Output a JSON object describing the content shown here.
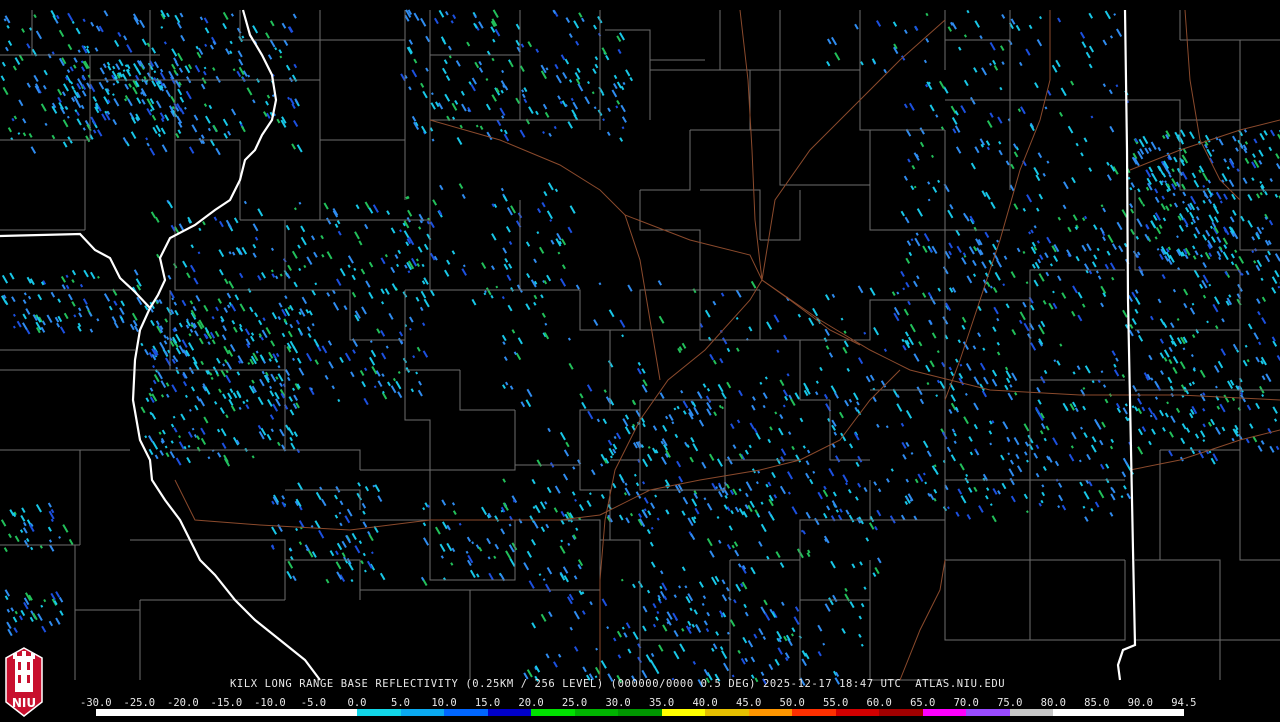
{
  "caption": {
    "text": "KILX LONG RANGE BASE REFLECTIVITY (0.25KM / 256 LEVEL) (000000/0000 0.5 DEG) 2025-12-17 18:47 UTC  ATLAS.NIU.EDU"
  },
  "logo": {
    "text": "NIU",
    "colors": {
      "bg": "#c8102e",
      "fg": "#ffffff"
    }
  },
  "color_scale": {
    "labels": [
      "-30.0",
      "-25.0",
      "-20.0",
      "-15.0",
      "-10.0",
      "-5.0",
      "0.0",
      "5.0",
      "10.0",
      "15.0",
      "20.0",
      "25.0",
      "30.0",
      "35.0",
      "40.0",
      "45.0",
      "50.0",
      "55.0",
      "60.0",
      "65.0",
      "70.0",
      "75.0",
      "80.0",
      "85.0",
      "90.0",
      "94.5"
    ],
    "colors": [
      "#ffffff",
      "#ffffff",
      "#ffffff",
      "#ffffff",
      "#ffffff",
      "#ffffff",
      "#12d6e8",
      "#0aa9f0",
      "#0066ff",
      "#0000c8",
      "#00e100",
      "#00b400",
      "#009600",
      "#ffff00",
      "#e6c000",
      "#ff9600",
      "#ff3000",
      "#d20000",
      "#a00000",
      "#ff00ff",
      "#9a4bff",
      "#c6c6c6",
      "#ffffff",
      "#ffffff",
      "#ffffff",
      "#ffffff"
    ]
  },
  "map_colors": {
    "background": "#000000",
    "county_lines": "#6e6e6e",
    "state_lines": "#ffffff",
    "highways": "#8b4a2c",
    "echo_light": "#18c8e8",
    "echo_mid": "#2f8cf0",
    "echo_dark": "#1c50e0",
    "echo_green": "#22c05a"
  }
}
